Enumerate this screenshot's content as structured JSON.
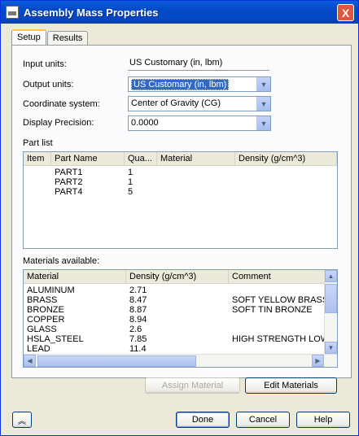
{
  "window": {
    "title": "Assembly Mass Properties",
    "close_glyph": "X"
  },
  "tabs": [
    {
      "label": "Setup"
    },
    {
      "label": "Results"
    }
  ],
  "fields": {
    "input_units": {
      "label": "Input units:",
      "value": "US Customary (in, lbm)"
    },
    "output_units": {
      "label": "Output units:",
      "value": "US Customary (in, lbm)"
    },
    "coordinate_system": {
      "label": "Coordinate system:",
      "value": "Center of Gravity (CG)"
    },
    "display_precision": {
      "label": "Display Precision:",
      "value": "0.0000"
    }
  },
  "part_list": {
    "label": "Part list",
    "columns": [
      "Item",
      "Part Name",
      "Qua...",
      "Material",
      "Density (g/cm^3)"
    ],
    "rows": [
      {
        "item": "",
        "name": "PART1",
        "qty": "1",
        "material": "",
        "density": ""
      },
      {
        "item": "",
        "name": "PART2",
        "qty": "1",
        "material": "",
        "density": ""
      },
      {
        "item": "",
        "name": "PART4",
        "qty": "5",
        "material": "",
        "density": ""
      }
    ]
  },
  "materials": {
    "label": "Materials available:",
    "columns": [
      "Material",
      "Density (g/cm^3)",
      "Comment"
    ],
    "rows": [
      {
        "material": "ALUMINUM",
        "density": "2.71",
        "comment": ""
      },
      {
        "material": "BRASS",
        "density": "8.47",
        "comment": "SOFT YELLOW BRASS"
      },
      {
        "material": "BRONZE",
        "density": "8.87",
        "comment": "SOFT TIN BRONZE"
      },
      {
        "material": "COPPER",
        "density": "8.94",
        "comment": ""
      },
      {
        "material": "GLASS",
        "density": "2.6",
        "comment": ""
      },
      {
        "material": "HSLA_STEEL",
        "density": "7.85",
        "comment": "HIGH STRENGTH LOW"
      },
      {
        "material": "LEAD",
        "density": "11.4",
        "comment": ""
      }
    ]
  },
  "buttons": {
    "assign_material": "Assign Material",
    "edit_materials": "Edit Materials",
    "done": "Done",
    "cancel": "Cancel",
    "help": "Help"
  },
  "icons": {
    "expand": "chevron-up-double-icon",
    "dropdown": "chevron-down-icon"
  }
}
